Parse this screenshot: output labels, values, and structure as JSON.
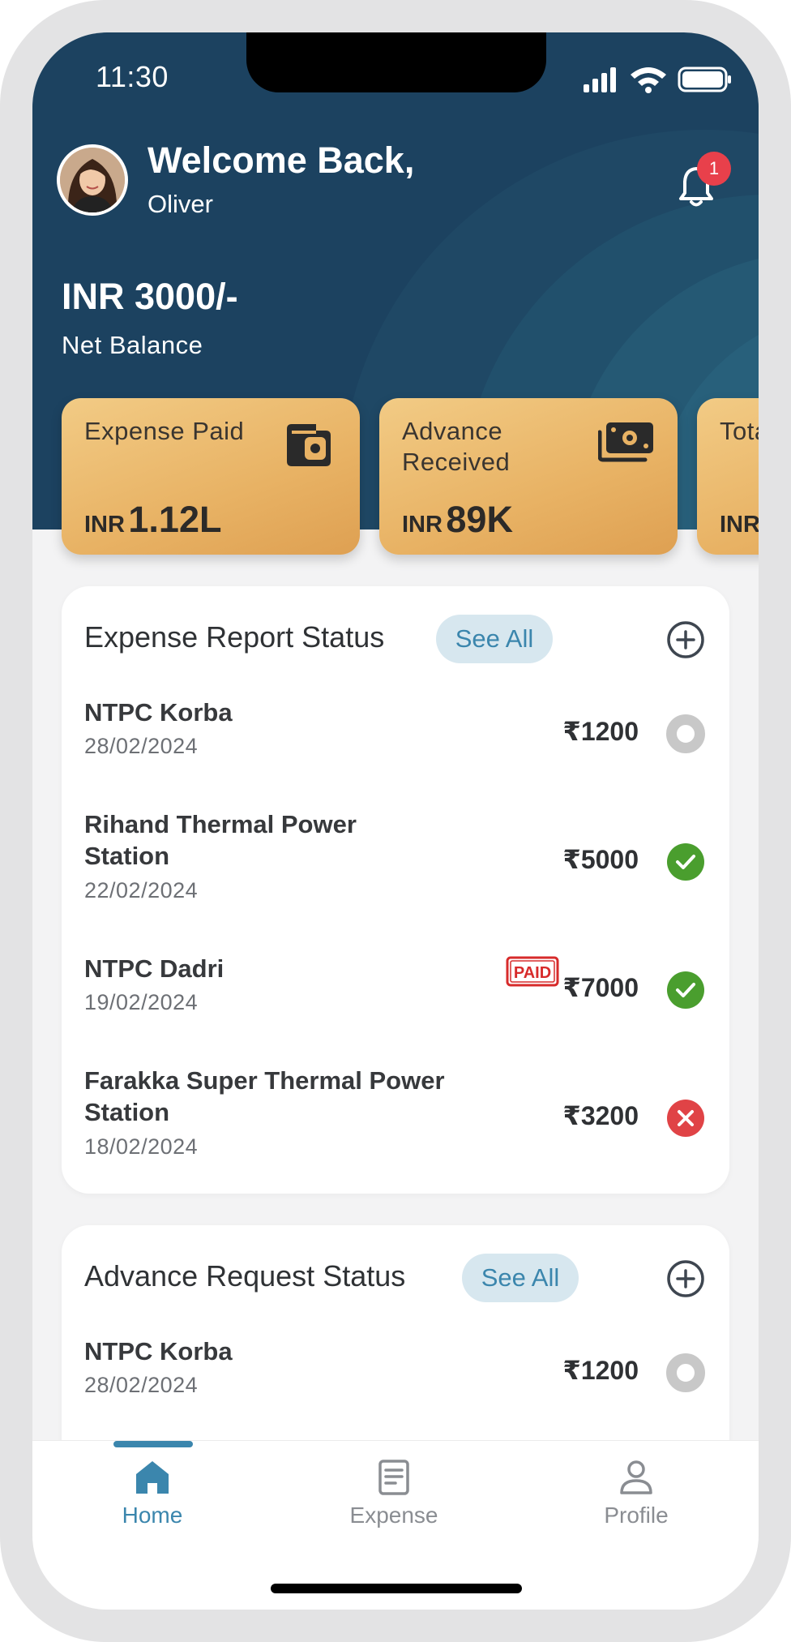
{
  "status_bar": {
    "time": "11:30"
  },
  "header": {
    "welcome": "Welcome Back,",
    "user_name": "Oliver",
    "notification_count": "1",
    "balance": "INR 3000/-",
    "balance_label": "Net Balance"
  },
  "summary_cards": [
    {
      "label": "Expense Paid",
      "currency": "INR",
      "value": "1.12L",
      "icon": "wallet-icon"
    },
    {
      "label": "Advance Received",
      "currency": "INR",
      "value": "89K",
      "icon": "cash-icon"
    },
    {
      "label": "Total Credit",
      "currency": "INR",
      "value": ""
    }
  ],
  "expense_report": {
    "title": "Expense Report Status",
    "see_all": "See All",
    "items": [
      {
        "name": "NTPC Korba",
        "date": "28/02/2024",
        "amount": "₹1200",
        "status": "pending",
        "paid": false
      },
      {
        "name": "Rihand Thermal Power Station",
        "date": "22/02/2024",
        "amount": "₹5000",
        "status": "approved",
        "paid": false
      },
      {
        "name": "NTPC Dadri",
        "date": "19/02/2024",
        "amount": "₹7000",
        "status": "approved",
        "paid": true,
        "paid_label": "PAID"
      },
      {
        "name": "Farakka Super Thermal Power Station",
        "date": "18/02/2024",
        "amount": "₹3200",
        "status": "rejected",
        "paid": false
      }
    ]
  },
  "advance_request": {
    "title": "Advance Request Status",
    "see_all": "See All",
    "items": [
      {
        "name": "NTPC Korba",
        "date": "28/02/2024",
        "amount": "₹1200",
        "status": "pending"
      }
    ]
  },
  "tabbar": {
    "home": "Home",
    "expense": "Expense",
    "profile": "Profile",
    "active": "home"
  },
  "colors": {
    "header_bg": "#1c4260",
    "accent": "#3b86ad",
    "card_gold": "#e8b264",
    "approved": "#4a9e2e",
    "rejected": "#e04346",
    "pending": "#c8c8c8"
  }
}
